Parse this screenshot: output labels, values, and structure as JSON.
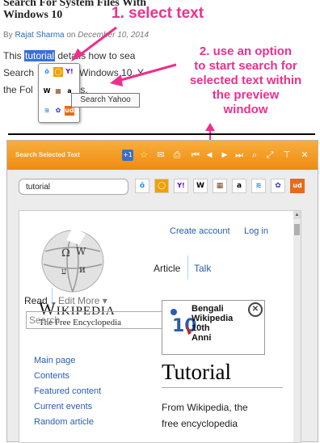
{
  "article": {
    "title_line1": "Search For System Files With",
    "title_line2": "Windows 10",
    "byline_prefix": "By ",
    "author": "Rajat Sharma",
    "byline_mid": " on ",
    "date": "December 10, 2014",
    "para_line1_before": "This ",
    "para_line1_selected": "tutorial",
    "para_line1_after": " details how to sea",
    "para_line2_a": "Search",
    "para_line2_b": "n Windows 10. Y",
    "para_line3_a": "the Fol",
    "para_line3_b": "ps."
  },
  "annotations": {
    "step1": "1. select text",
    "step2_l1": "2. use an option",
    "step2_l2": "to start search for",
    "step2_l3": "selected text within",
    "step2_l4": "the preview",
    "step2_l5": "window"
  },
  "mini_popup": {
    "tooltip": "Search Yahoo",
    "icons": [
      "duckduckgo-icon",
      "bing-icon",
      "yahoo-icon",
      "wikipedia-icon",
      "imdb-icon",
      "amazon-icon",
      "bookmark-icon",
      "baidu-icon",
      "urban-dictionary-icon"
    ]
  },
  "preview": {
    "title": "Search Selected Text",
    "search_value": "tutorial",
    "toolbar_icons": [
      "plus-one-icon",
      "add-favorite-icon",
      "mail-icon",
      "printer-icon",
      "first-icon",
      "prev-icon",
      "next-icon",
      "last-icon",
      "zoom-icon",
      "expand-icon",
      "pin-icon",
      "close-icon"
    ],
    "toolbar_glyphs": [
      "+1",
      "☆",
      "✉",
      "⎙",
      "⏮",
      "◀",
      "▶",
      "⏭",
      "⌕",
      "⤢",
      "📌",
      "✕"
    ],
    "engines": [
      {
        "name": "duckduckgo-icon",
        "glyph": "ö",
        "color": "#2a8ad8"
      },
      {
        "name": "bing-icon",
        "glyph": "◯",
        "color": "#f0a000"
      },
      {
        "name": "yahoo-icon",
        "glyph": "Y!",
        "color": "#6001d2"
      },
      {
        "name": "wikipedia-icon",
        "glyph": "W",
        "color": "#000000"
      },
      {
        "name": "imdb-icon",
        "glyph": "▦",
        "color": "#7a4a1a"
      },
      {
        "name": "amazon-icon",
        "glyph": "a",
        "color": "#000000"
      },
      {
        "name": "bookmark-icon",
        "glyph": "≋",
        "color": "#2a8ad8"
      },
      {
        "name": "baidu-icon",
        "glyph": "🐾",
        "color": "#2932e1"
      },
      {
        "name": "urban-dictionary-icon",
        "glyph": "ud",
        "color": "#ffffff"
      }
    ]
  },
  "wiki": {
    "create_account": "Create account",
    "log_in": "Log in",
    "tab_article": "Article",
    "tab_talk": "Talk",
    "tab_read": "Read",
    "tab_edit": "Edit",
    "tab_more": "More",
    "logo_word": "Wikipedia",
    "tagline": "The Free Encyclopedia",
    "search_placeholder": "Search",
    "banner_l1": "Bengali",
    "banner_l2": "Wikipedia",
    "banner_l3": "10th",
    "banner_l4": "Anni",
    "page_title": "Tutorial",
    "from_l1": "From Wikipedia, the",
    "from_l2": "free encyclopedia",
    "nav": [
      "Main page",
      "Contents",
      "Featured content",
      "Current events",
      "Random article"
    ]
  }
}
